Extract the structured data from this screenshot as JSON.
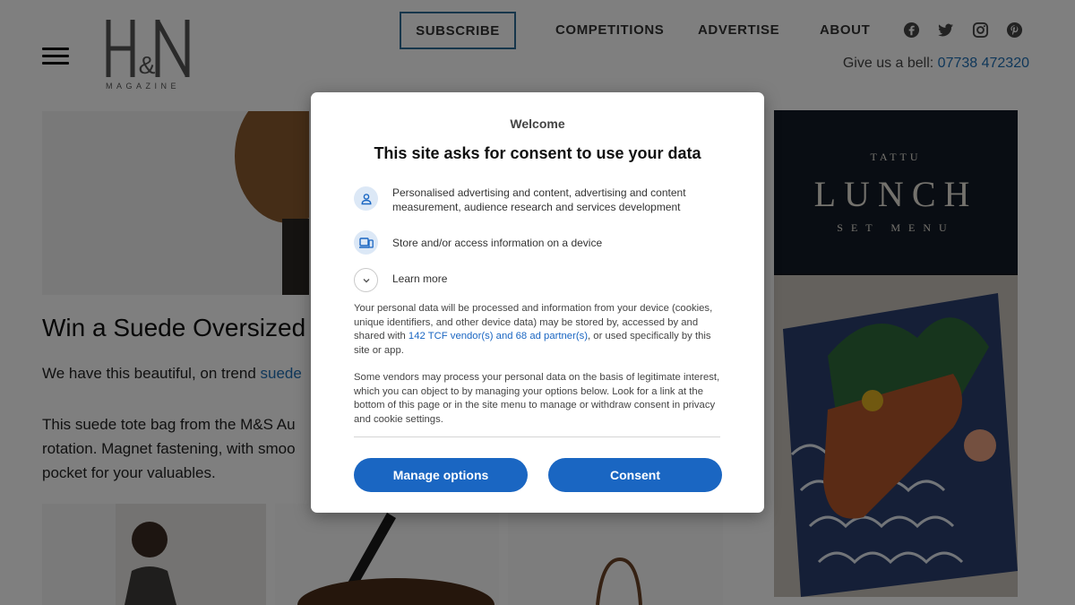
{
  "site": {
    "logo_letters": "H&N",
    "logo_sub": "MAGAZINE",
    "nav": {
      "subscribe": "SUBSCRIBE",
      "competitions": "COMPETITIONS",
      "advertise": "ADVERTISE",
      "about": "ABOUT"
    },
    "social_icons": [
      "facebook-icon",
      "twitter-icon",
      "instagram-icon",
      "pinterest-icon"
    ],
    "phone_label": "Give us a bell: ",
    "phone_number": "07738 472320",
    "link_color": "#1f6fb5"
  },
  "article": {
    "title": "Win a Suede Oversized",
    "lead_text": "We have this beautiful, on trend ",
    "lead_link": "suede",
    "body_lines": [
      "This suede tote bag from the M&S Au",
      "rotation. Magnet fastening, with smoo",
      "pocket for your valuables."
    ]
  },
  "ad": {
    "brand": "TATTU",
    "title": "LUNCH",
    "subtitle": "SET MENU"
  },
  "consent": {
    "welcome": "Welcome",
    "title": "This site asks for consent to use your data",
    "purposes": [
      {
        "icon": "person-icon",
        "text": "Personalised advertising and content, advertising and content measurement, audience research and services development"
      },
      {
        "icon": "devices-icon",
        "text": "Store and/or access information on a device"
      }
    ],
    "learn_more": "Learn more",
    "para1_before": "Your personal data will be processed and information from your device (cookies, unique identifiers, and other device data) may be stored by, accessed by and shared with ",
    "para1_link": "142 TCF vendor(s) and 68 ad partner(s)",
    "para1_after": ", or used specifically by this site or app.",
    "para2": "Some vendors may process your personal data on the basis of legitimate interest, which you can object to by managing your options below. Look for a link at the bottom of this page or in the site menu to manage or withdraw consent in privacy and cookie settings.",
    "manage_button": "Manage options",
    "consent_button": "Consent",
    "accent_color": "#1a66c2"
  }
}
